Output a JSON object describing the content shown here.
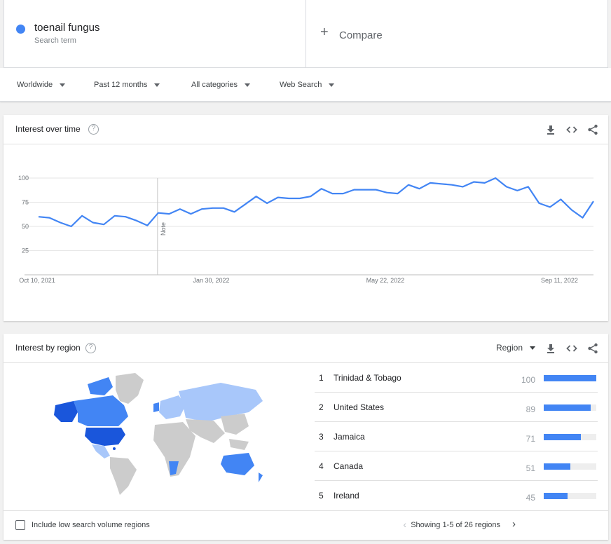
{
  "search_term": {
    "name": "toenail fungus",
    "subtitle": "Search term",
    "color": "#4285f4"
  },
  "compare": {
    "plus": "+",
    "label": "Compare"
  },
  "filters": [
    {
      "label": "Worldwide"
    },
    {
      "label": "Past 12 months"
    },
    {
      "label": "All categories"
    },
    {
      "label": "Web Search"
    }
  ],
  "interest_over_time": {
    "title": "Interest over time",
    "help": "?",
    "note_label": "Note",
    "icons": [
      "download-icon",
      "embed-icon",
      "share-icon"
    ]
  },
  "chart_data": {
    "type": "line",
    "title": "",
    "xlabel": "",
    "ylabel": "",
    "ylim": [
      0,
      100
    ],
    "yticks": [
      25,
      50,
      75,
      100
    ],
    "x_tick_labels": [
      {
        "label": "Oct 10, 2021",
        "index": 0
      },
      {
        "label": "Jan 30, 2022",
        "index": 16
      },
      {
        "label": "May 22, 2022",
        "index": 32
      },
      {
        "label": "Sep 11, 2022",
        "index": 48
      }
    ],
    "note_index": 11,
    "grid": true,
    "series": [
      {
        "color": "#4285f4",
        "values": [
          60,
          59,
          54,
          50,
          61,
          54,
          52,
          61,
          60,
          56,
          51,
          64,
          63,
          68,
          63,
          68,
          69,
          69,
          65,
          73,
          81,
          74,
          80,
          79,
          79,
          81,
          89,
          84,
          84,
          88,
          88,
          88,
          85,
          84,
          93,
          89,
          95,
          94,
          93,
          91,
          96,
          95,
          100,
          91,
          87,
          91,
          74,
          70,
          78,
          67,
          59,
          76
        ]
      }
    ]
  },
  "interest_by_region": {
    "title": "Interest by region",
    "help": "?",
    "selector": "Region",
    "icons": [
      "download-icon",
      "embed-icon",
      "share-icon"
    ],
    "regions": [
      {
        "rank": "1",
        "name": "Trinidad & Tobago",
        "value": 100
      },
      {
        "rank": "2",
        "name": "United States",
        "value": 89
      },
      {
        "rank": "3",
        "name": "Jamaica",
        "value": 71
      },
      {
        "rank": "4",
        "name": "Canada",
        "value": 51
      },
      {
        "rank": "5",
        "name": "Ireland",
        "value": 45
      }
    ],
    "checkbox_label": "Include low search volume regions",
    "pager_text": "Showing 1-5 of 26 regions",
    "prev_glyph": "‹",
    "next_glyph": "›"
  }
}
